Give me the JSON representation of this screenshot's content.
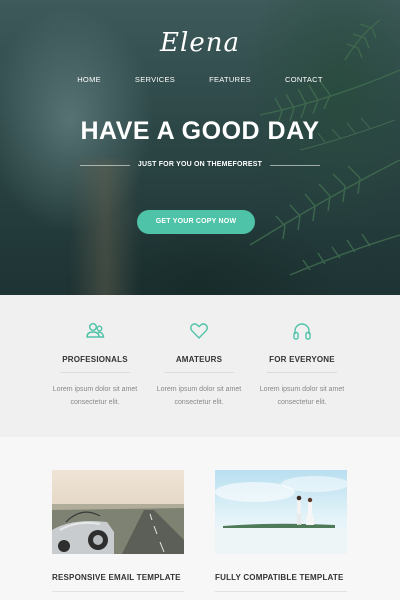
{
  "brand": {
    "logo_text": "Elena"
  },
  "nav": {
    "items": [
      {
        "label": "HOME"
      },
      {
        "label": "SERVICES"
      },
      {
        "label": "FEATURES"
      },
      {
        "label": "CONTACT"
      }
    ]
  },
  "hero": {
    "title": "HAVE A GOOD DAY",
    "subtitle": "JUST FOR YOU ON THEMEFOREST",
    "cta_label": "GET YOUR COPY NOW"
  },
  "features": [
    {
      "icon": "users-icon",
      "title": "PROFESIONALS",
      "desc_line1": "Lorem ipsum dolor sit amet",
      "desc_line2": "consectetur elit."
    },
    {
      "icon": "heart-icon",
      "title": "AMATEURS",
      "desc_line1": "Lorem ipsum dolor sit amet",
      "desc_line2": "consectetur elit."
    },
    {
      "icon": "headphones-icon",
      "title": "FOR EVERYONE",
      "desc_line1": "Lorem ipsum dolor sit amet",
      "desc_line2": "consectetur elit."
    }
  ],
  "products": [
    {
      "title": "RESPONSIVE EMAIL TEMPLATE"
    },
    {
      "title": "FULLY COMPATIBLE TEMPLATE"
    }
  ],
  "colors": {
    "accent": "#4fc3a8",
    "hero_dark": "#2c4646",
    "text_dark": "#333333",
    "text_muted": "#888888"
  }
}
